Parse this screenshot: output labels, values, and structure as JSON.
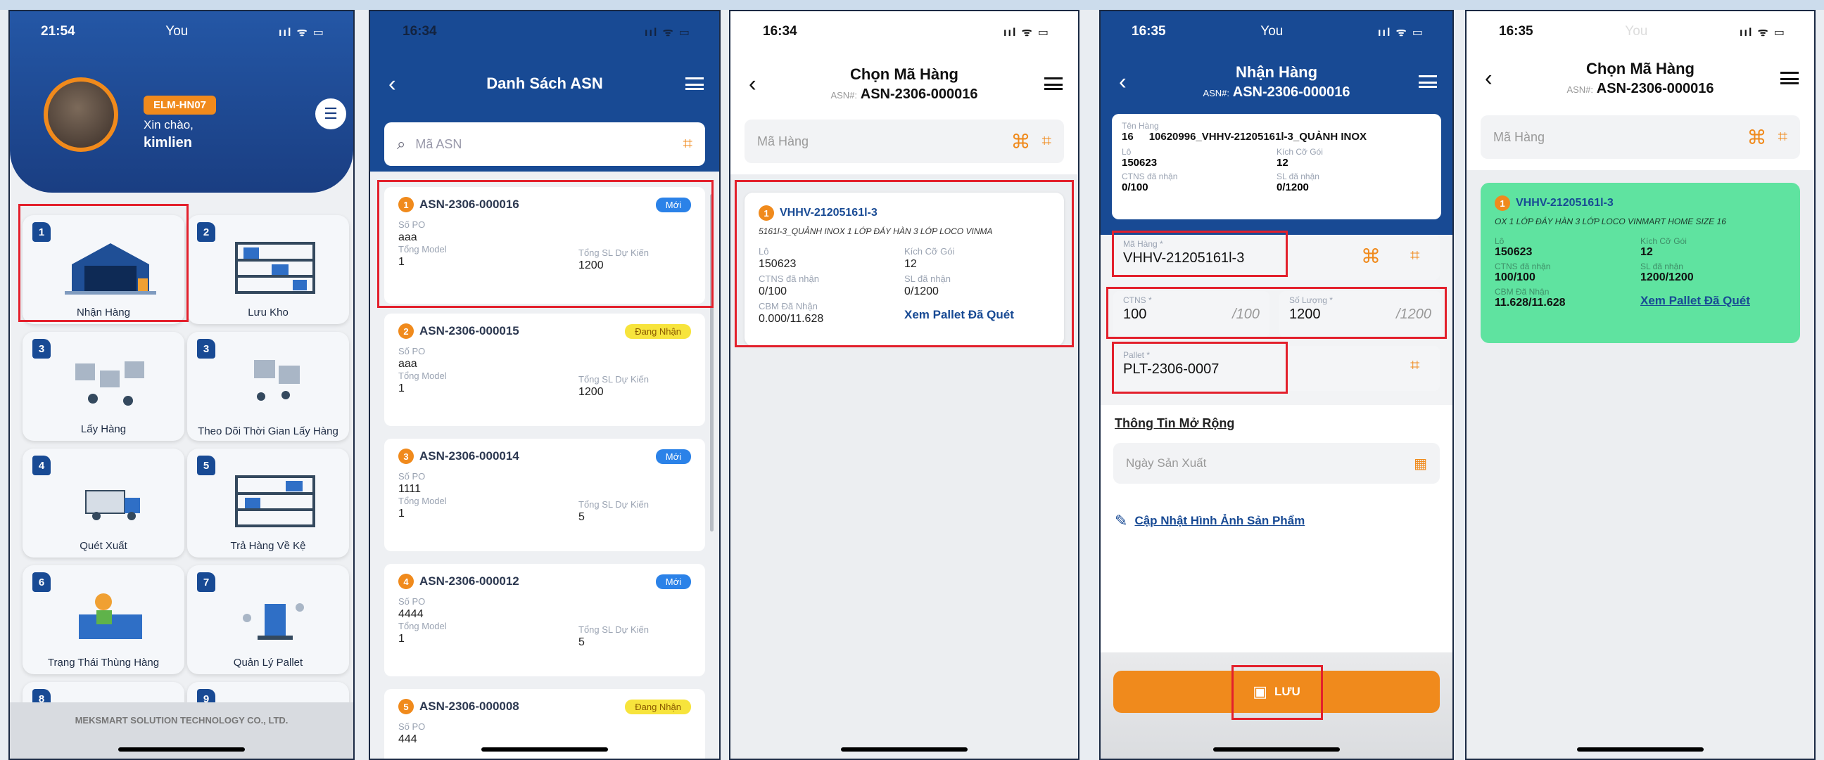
{
  "panel1": {
    "status_time": "21:54",
    "status_carrier": "You",
    "status_icons": "ııl ᯤ ▭",
    "badge": "ELM-HN07",
    "greeting": "Xin chào,",
    "username": "kimlien",
    "menu_icon": "list-icon",
    "tiles": [
      {
        "num": "1",
        "label": "Nhận Hàng"
      },
      {
        "num": "2",
        "label": "Lưu Kho"
      },
      {
        "num": "3",
        "label": "Lấy Hàng"
      },
      {
        "num": "3",
        "label": "Theo Dõi Thời Gian Lấy Hàng"
      },
      {
        "num": "4",
        "label": "Quét Xuất"
      },
      {
        "num": "5",
        "label": "Trả Hàng Về Kệ"
      },
      {
        "num": "6",
        "label": "Trạng Thái Thùng Hàng"
      },
      {
        "num": "7",
        "label": "Quản Lý Pallet"
      },
      {
        "num": "8",
        "label": ""
      },
      {
        "num": "9",
        "label": ""
      }
    ],
    "footer": "MEKSMART SOLUTION TECHNOLOGY CO., LTD."
  },
  "panel2": {
    "status_time": "16:34",
    "status_icons": "ııl ᯤ ▭",
    "title": "Danh Sách ASN",
    "search_placeholder": "Mã ASN",
    "label_po": "Số PO",
    "label_model": "Tổng Model",
    "label_expected": "Tổng SL Dự Kiến",
    "items": [
      {
        "n": "1",
        "id": "ASN-2306-000016",
        "status": "Mới",
        "status_kind": "new",
        "po": "aaa",
        "model": "1",
        "qty": "1200"
      },
      {
        "n": "2",
        "id": "ASN-2306-000015",
        "status": "Đang Nhận",
        "status_kind": "rcv",
        "po": "aaa",
        "model": "1",
        "qty": "1200"
      },
      {
        "n": "3",
        "id": "ASN-2306-000014",
        "status": "Mới",
        "status_kind": "new",
        "po": "1111",
        "model": "1",
        "qty": "5"
      },
      {
        "n": "4",
        "id": "ASN-2306-000012",
        "status": "Mới",
        "status_kind": "new",
        "po": "4444",
        "model": "1",
        "qty": "5"
      },
      {
        "n": "5",
        "id": "ASN-2306-000008",
        "status": "Đang Nhận",
        "status_kind": "rcv",
        "po": "444",
        "model": "",
        "qty": ""
      }
    ]
  },
  "panel3": {
    "status_time": "16:34",
    "status_icons": "ııl ᯤ ▭",
    "title": "Chọn Mã Hàng",
    "asn_label": "ASN#:",
    "asn": "ASN-2306-000016",
    "code_placeholder": "Mã Hàng",
    "item": {
      "n": "1",
      "code": "VHHV-21205161l-3",
      "desc": "5161l-3_QUẢNH INOX 1 LỚP ĐÁY HÀN 3 LỚP LOCO VINMA",
      "lo_label": "Lô",
      "lo": "150623",
      "size_label": "Kích Cỡ Gói",
      "size": "12",
      "ctns_label": "CTNS đã nhận",
      "ctns": "0/100",
      "sl_label": "SL đã nhận",
      "sl": "0/1200",
      "cbm_label": "CBM Đã Nhận",
      "cbm": "0.000/11.628",
      "link": "Xem Pallet Đã Quét"
    }
  },
  "panel4": {
    "status_time": "16:35",
    "status_carrier": "You",
    "status_icons": "ııl ᯤ ▭",
    "title": "Nhận Hàng",
    "asn_label": "ASN#:",
    "asn": "ASN-2306-000016",
    "name_label": "Tên Hàng",
    "name_num": "16",
    "name_value": "10620996_VHHV-21205161l-3_QUẢNH INOX",
    "lo_label": "Lô",
    "lo": "150623",
    "size_label": "Kích Cỡ Gói",
    "size": "12",
    "ctns_label": "CTNS đã nhận",
    "ctns": "0/100",
    "sl_label": "SL đã nhận",
    "sl": "0/1200",
    "code_label": "Mã Hàng *",
    "code_value": "VHHV-21205161l-3",
    "ctns_in_label": "CTNS *",
    "ctns_in": "100",
    "ctns_max": "/100",
    "qty_in_label": "Số Lượng *",
    "qty_in": "1200",
    "qty_max": "/1200",
    "pallet_label": "Pallet *",
    "pallet_value": "PLT-2306-0007",
    "ext_title": "Thông Tin Mở Rộng",
    "mfg_placeholder": "Ngày Sản Xuất",
    "update_link": "Cập Nhật Hình Ảnh Sản Phẩm",
    "save": "LƯU"
  },
  "panel5": {
    "status_time": "16:35",
    "status_carrier": "You",
    "status_icons": "ııl ᯤ ▭",
    "title": "Chọn Mã Hàng",
    "asn_label": "ASN#:",
    "asn": "ASN-2306-000016",
    "code_placeholder": "Mã Hàng",
    "item": {
      "n": "1",
      "code": "VHHV-21205161l-3",
      "desc": "OX 1 LỚP ĐÁY HÀN 3 LỚP LOCO VINMART HOME SIZE 16",
      "lo_label": "Lô",
      "lo": "150623",
      "size_label": "Kích Cỡ Gói",
      "size": "12",
      "ctns_label": "CTNS đã nhận",
      "ctns": "100/100",
      "sl_label": "SL đã nhận",
      "sl": "1200/1200",
      "cbm_label": "CBM Đã Nhận",
      "cbm": "11.628/11.628",
      "link": "Xem Pallet Đã Quét"
    }
  },
  "colors": {
    "navy": "#184a94",
    "orange": "#f08a1c",
    "highlight": "#e3202c",
    "done_green": "#5fe3a0"
  }
}
